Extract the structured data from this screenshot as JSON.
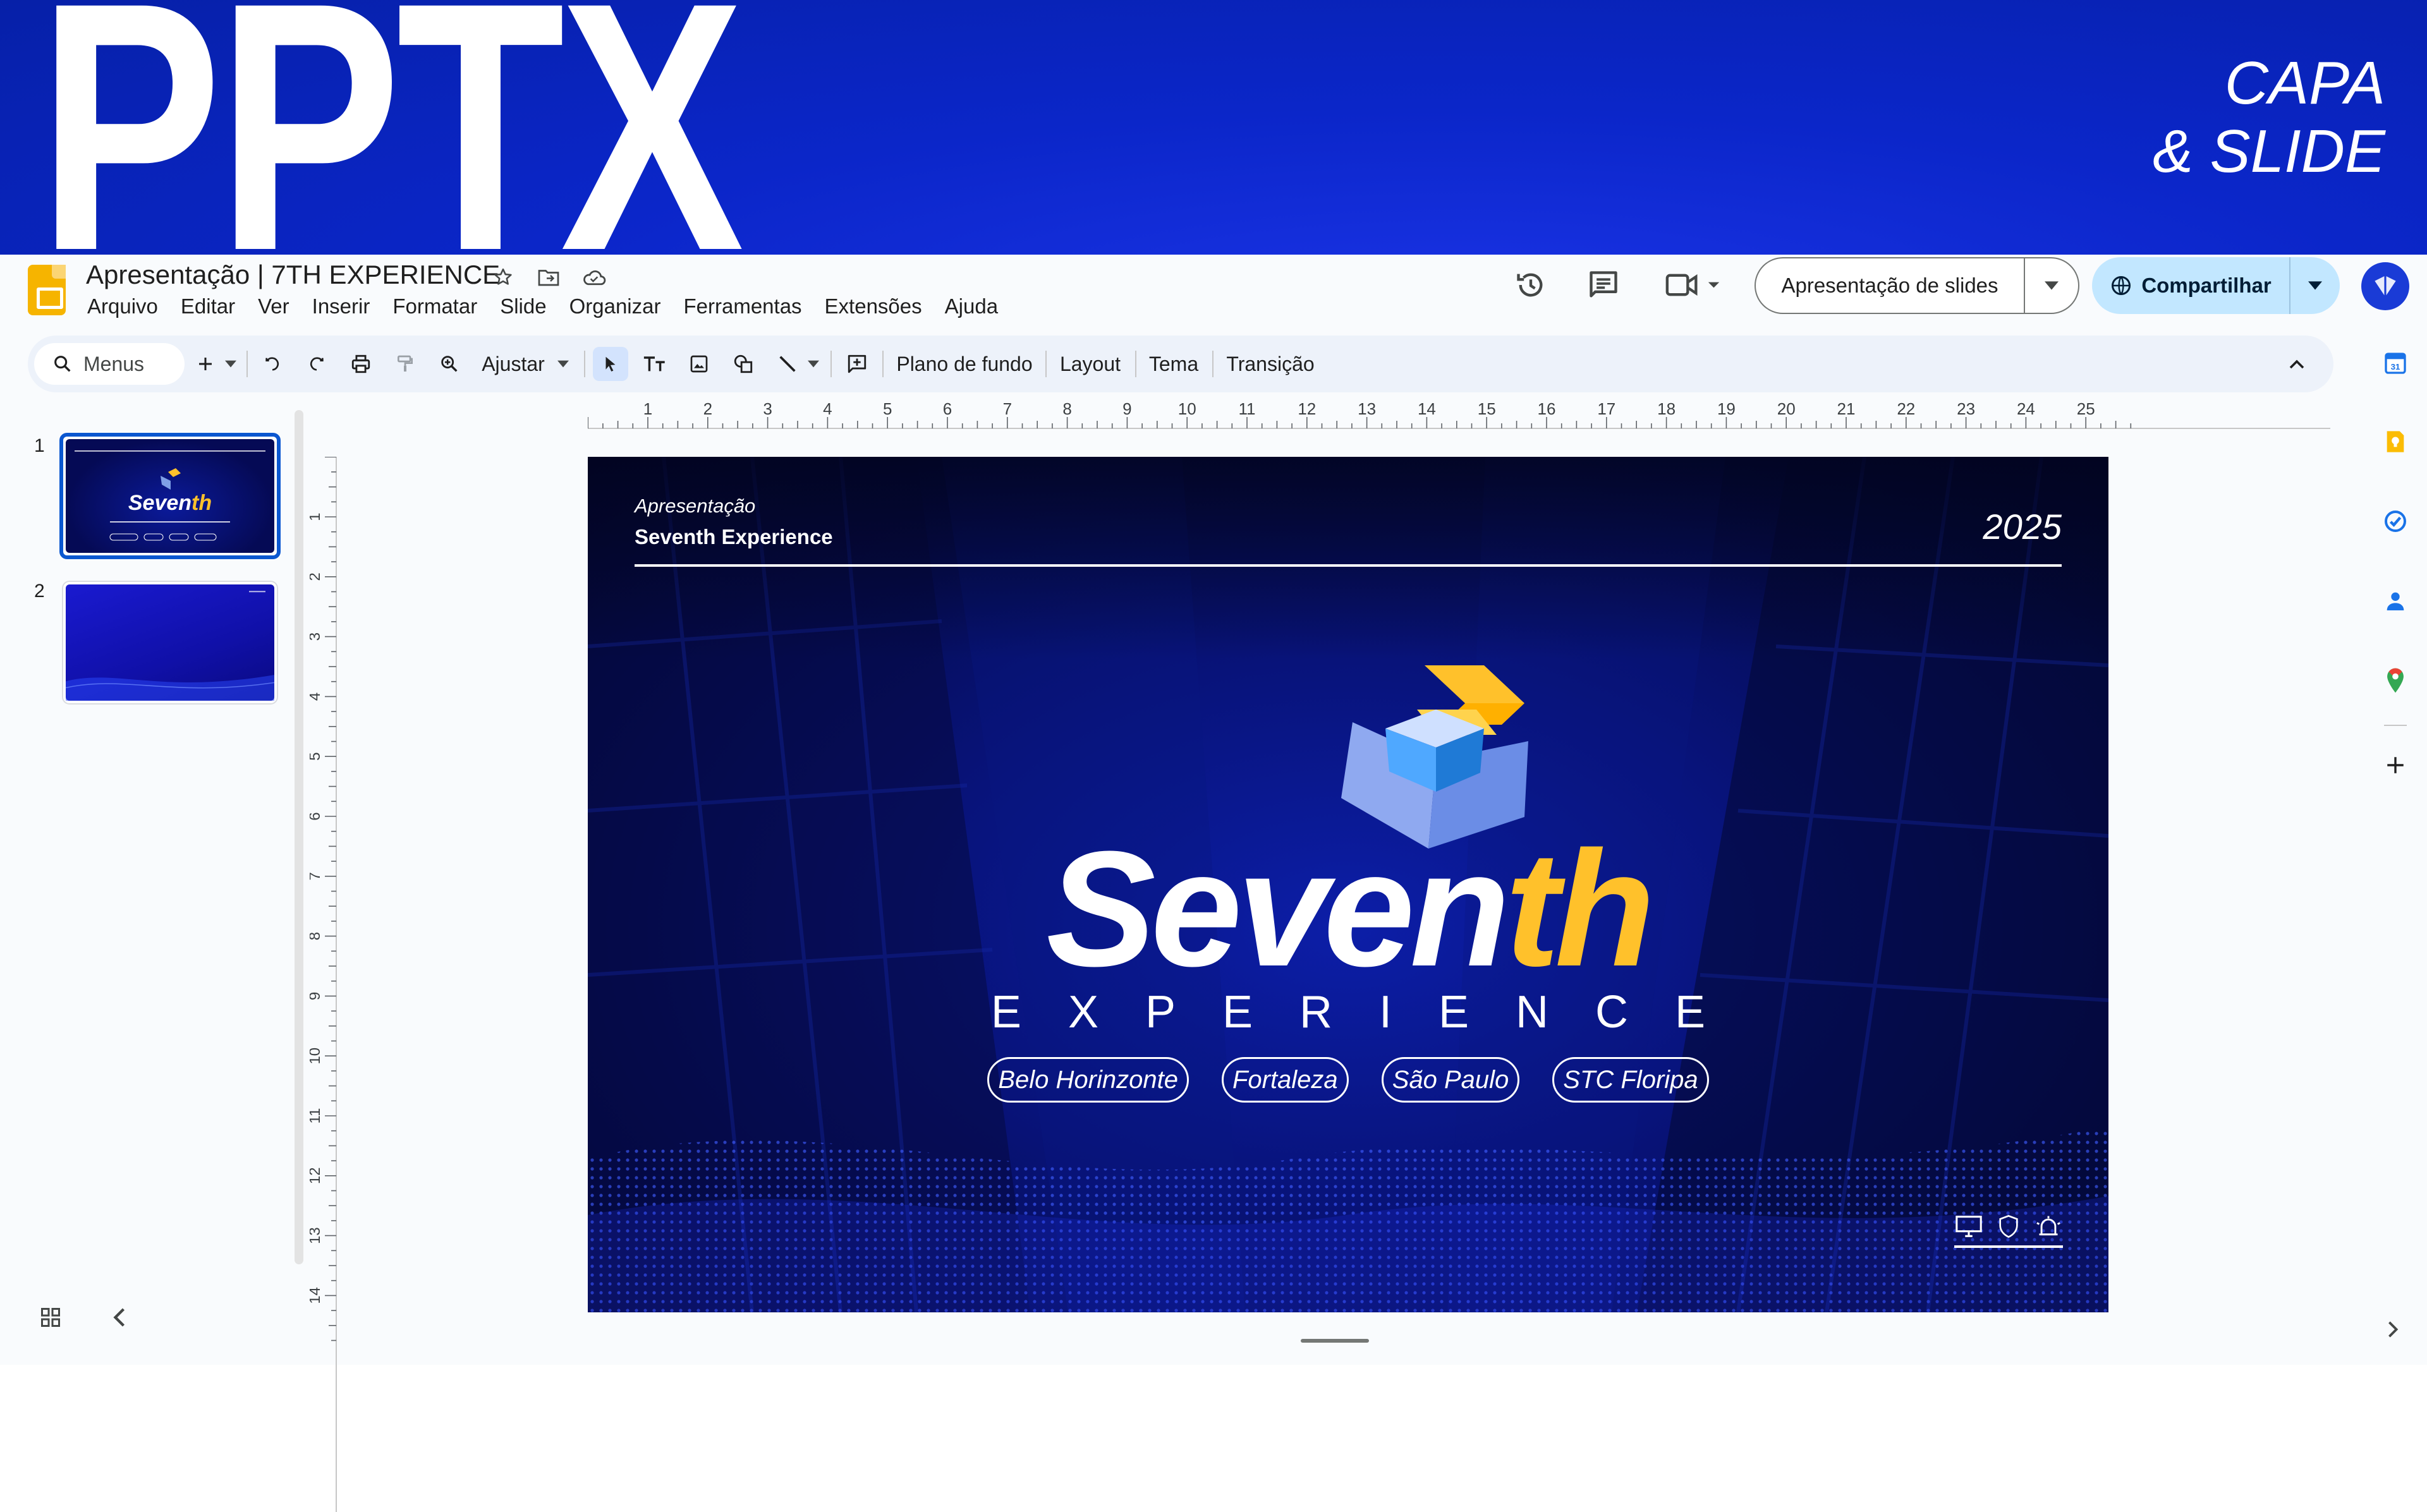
{
  "banner": {
    "logo_text": "PPTX",
    "caption_line1": "CAPA",
    "caption_line2": "& SLIDE"
  },
  "app": {
    "doc_title": "Apresentação | 7TH EXPERIENCE",
    "menu": [
      "Arquivo",
      "Editar",
      "Ver",
      "Inserir",
      "Formatar",
      "Slide",
      "Organizar",
      "Ferramentas",
      "Extensões",
      "Ajuda"
    ],
    "slideshow_label": "Apresentação de slides",
    "share_label": "Compartilhar"
  },
  "toolbar": {
    "search_label": "Menus",
    "zoom_label": "Ajustar",
    "background_label": "Plano de fundo",
    "layout_label": "Layout",
    "theme_label": "Tema",
    "transition_label": "Transição"
  },
  "filmstrip": {
    "thumbs": [
      {
        "number": "1"
      },
      {
        "number": "2"
      }
    ]
  },
  "ruler": {
    "horizontal": [
      "1",
      "2",
      "3",
      "4",
      "5",
      "6",
      "7",
      "8",
      "9",
      "10",
      "11",
      "12",
      "13",
      "14",
      "15",
      "16",
      "17",
      "18",
      "19",
      "20",
      "21",
      "22",
      "23",
      "24",
      "25"
    ],
    "vertical": [
      "1",
      "2",
      "3",
      "4",
      "5",
      "6",
      "7",
      "8",
      "9",
      "10",
      "11",
      "12",
      "13",
      "14"
    ]
  },
  "slide": {
    "subtitle": "Apresentação",
    "name": "Seventh Experience",
    "year": "2025",
    "brand_white": "Seven",
    "brand_yellow": "th",
    "brand_sub": "EXPERIENCE",
    "cities": [
      "Belo Horinzonte",
      "Fortaleza",
      "São Paulo",
      "STC Floripa"
    ],
    "colors": {
      "accent": "#ffc12b",
      "background": "#08137a",
      "banner": "#0b26c9"
    }
  },
  "icons": {
    "toolbar": [
      "search-icon",
      "plus-icon",
      "undo-icon",
      "redo-icon",
      "print-icon",
      "paint-format-icon",
      "zoom-icon",
      "select-cursor-icon",
      "text-box-icon",
      "image-icon",
      "shape-icon",
      "line-icon",
      "comment-add-icon",
      "collapse-toolbar-icon"
    ],
    "side_panel": [
      "calendar-icon",
      "keep-icon",
      "tasks-icon",
      "contacts-icon",
      "maps-icon",
      "add-addon-icon"
    ]
  }
}
